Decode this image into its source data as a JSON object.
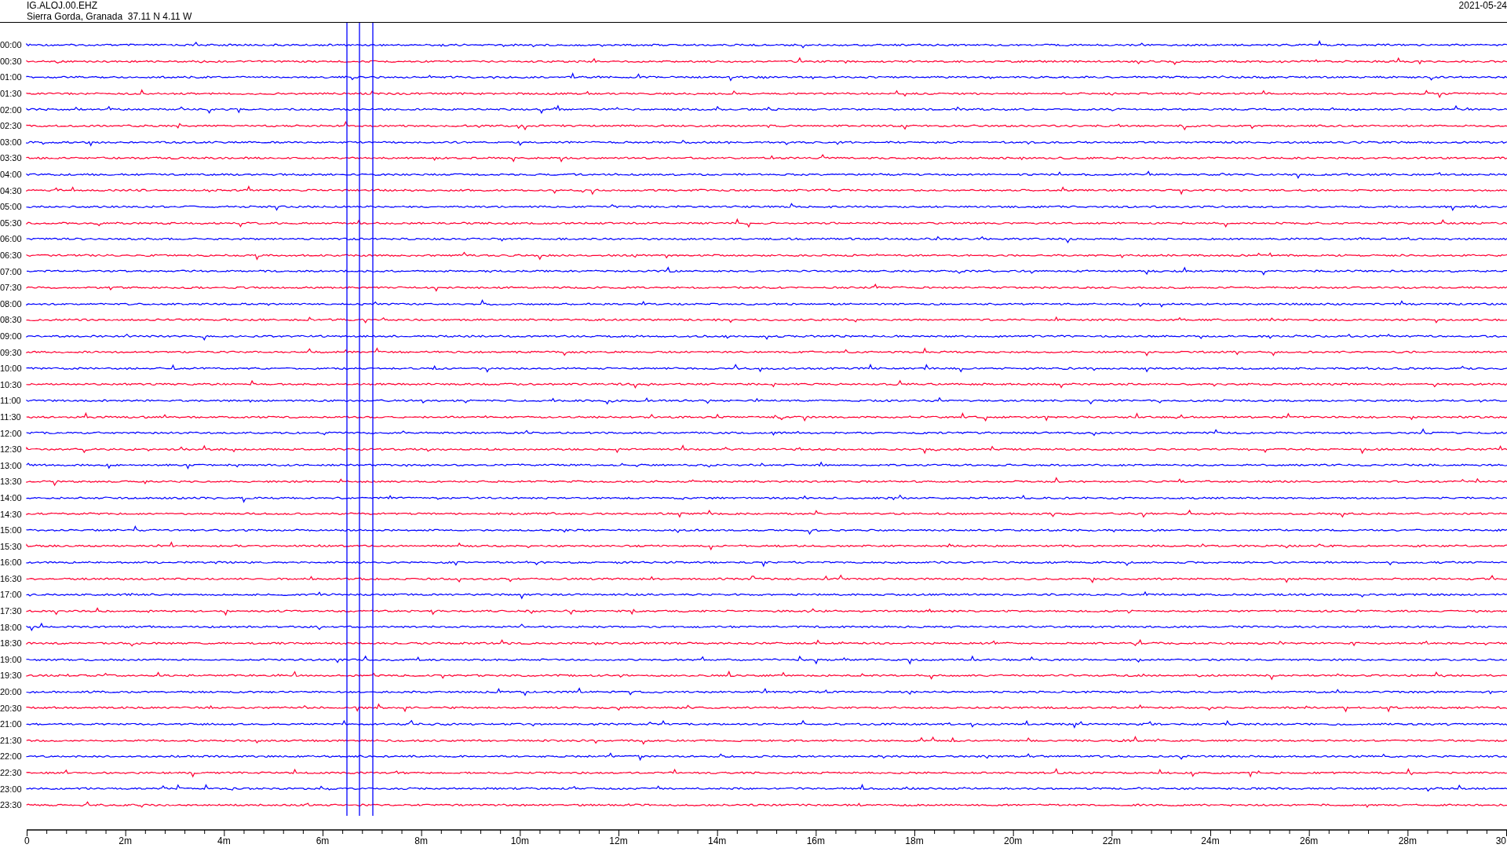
{
  "header": {
    "station": "IG.ALOJ.00.EHZ",
    "location": "Sierra Gorda, Granada  37.11 N 4.11 W",
    "date": "2021-05-24"
  },
  "rows": [
    {
      "time": "00:00",
      "color": "#0000ff"
    },
    {
      "time": "00:30",
      "color": "#ff0033"
    },
    {
      "time": "01:00",
      "color": "#0000ff"
    },
    {
      "time": "01:30",
      "color": "#ff0033"
    },
    {
      "time": "02:00",
      "color": "#0000ff"
    },
    {
      "time": "02:30",
      "color": "#ff0033"
    },
    {
      "time": "03:00",
      "color": "#0000ff"
    },
    {
      "time": "03:30",
      "color": "#ff0033"
    },
    {
      "time": "04:00",
      "color": "#0000ff"
    },
    {
      "time": "04:30",
      "color": "#ff0033"
    },
    {
      "time": "05:00",
      "color": "#0000ff"
    },
    {
      "time": "05:30",
      "color": "#ff0033"
    },
    {
      "time": "06:00",
      "color": "#0000ff"
    },
    {
      "time": "06:30",
      "color": "#ff0033"
    },
    {
      "time": "07:00",
      "color": "#0000ff"
    },
    {
      "time": "07:30",
      "color": "#ff0033"
    },
    {
      "time": "08:00",
      "color": "#0000ff"
    },
    {
      "time": "08:30",
      "color": "#ff0033"
    },
    {
      "time": "09:00",
      "color": "#0000ff"
    },
    {
      "time": "09:30",
      "color": "#ff0033"
    },
    {
      "time": "10:00",
      "color": "#0000ff"
    },
    {
      "time": "10:30",
      "color": "#ff0033"
    },
    {
      "time": "11:00",
      "color": "#0000ff"
    },
    {
      "time": "11:30",
      "color": "#ff0033"
    },
    {
      "time": "12:00",
      "color": "#0000ff"
    },
    {
      "time": "12:30",
      "color": "#ff0033"
    },
    {
      "time": "13:00",
      "color": "#0000ff"
    },
    {
      "time": "13:30",
      "color": "#ff0033"
    },
    {
      "time": "14:00",
      "color": "#0000ff"
    },
    {
      "time": "14:30",
      "color": "#ff0033"
    },
    {
      "time": "15:00",
      "color": "#0000ff"
    },
    {
      "time": "15:30",
      "color": "#ff0033"
    },
    {
      "time": "16:00",
      "color": "#0000ff"
    },
    {
      "time": "16:30",
      "color": "#ff0033"
    },
    {
      "time": "17:00",
      "color": "#0000ff"
    },
    {
      "time": "17:30",
      "color": "#ff0033"
    },
    {
      "time": "18:00",
      "color": "#0000ff"
    },
    {
      "time": "18:30",
      "color": "#ff0033"
    },
    {
      "time": "19:00",
      "color": "#0000ff"
    },
    {
      "time": "19:30",
      "color": "#ff0033"
    },
    {
      "time": "20:00",
      "color": "#0000ff"
    },
    {
      "time": "20:30",
      "color": "#ff0033"
    },
    {
      "time": "21:00",
      "color": "#0000ff"
    },
    {
      "time": "21:30",
      "color": "#ff0033"
    },
    {
      "time": "22:00",
      "color": "#0000ff"
    },
    {
      "time": "22:30",
      "color": "#ff0033"
    },
    {
      "time": "23:00",
      "color": "#0000ff"
    },
    {
      "time": "23:30",
      "color": "#ff0033"
    }
  ],
  "x_axis": {
    "ticks": [
      "0",
      "2m",
      "4m",
      "6m",
      "8m",
      "10m",
      "12m",
      "14m",
      "16m",
      "18m",
      "20m",
      "22m",
      "24m",
      "26m",
      "28m",
      "30"
    ]
  }
}
